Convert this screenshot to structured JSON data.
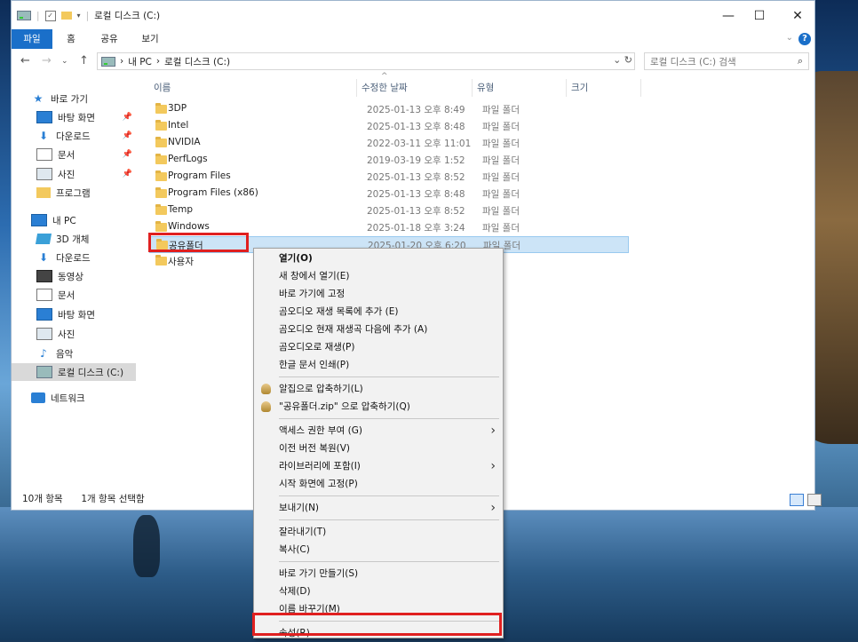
{
  "window": {
    "title": "로컬 디스크 (C:)",
    "controls": {
      "minimize": "—",
      "maximize": "☐",
      "close": "✕"
    }
  },
  "ribbon": {
    "tabs": [
      "파일",
      "홈",
      "공유",
      "보기"
    ]
  },
  "nav": {
    "back": "←",
    "forward": "→",
    "recent": "⌄",
    "up": "↑",
    "breadcrumb": [
      "내 PC",
      "로컬 디스크 (C:)"
    ],
    "breadcrumb_sep": "›",
    "refresh": "⌄ ↻",
    "search_placeholder": "로컬 디스크 (C:) 검색"
  },
  "sidebar": {
    "items": [
      {
        "label": "바로 가기",
        "icon": "star-icon"
      },
      {
        "label": "바탕 화면",
        "icon": "desktop-icon",
        "pinned": true
      },
      {
        "label": "다운로드",
        "icon": "download-icon",
        "pinned": true
      },
      {
        "label": "문서",
        "icon": "document-icon",
        "pinned": true
      },
      {
        "label": "사진",
        "icon": "pictures-icon",
        "pinned": true
      },
      {
        "label": "프로그램",
        "icon": "folder-icon"
      },
      {
        "label": "내 PC",
        "icon": "pc-icon"
      },
      {
        "label": "3D 개체",
        "icon": "3d-objects-icon"
      },
      {
        "label": "다운로드",
        "icon": "download-icon"
      },
      {
        "label": "동영상",
        "icon": "video-icon"
      },
      {
        "label": "문서",
        "icon": "document-icon"
      },
      {
        "label": "바탕 화면",
        "icon": "desktop-icon"
      },
      {
        "label": "사진",
        "icon": "pictures-icon"
      },
      {
        "label": "음악",
        "icon": "music-icon"
      },
      {
        "label": "로컬 디스크 (C:)",
        "icon": "drive-icon",
        "selected": true
      },
      {
        "label": "네트워크",
        "icon": "network-icon"
      }
    ],
    "pin_glyph": "📌"
  },
  "columns": [
    "이름",
    "수정한 날짜",
    "유형",
    "크기"
  ],
  "sort_glyph": "^",
  "files": [
    {
      "name": "3DP",
      "date": "2025-01-13 오후 8:49",
      "type": "파일 폴더"
    },
    {
      "name": "Intel",
      "date": "2025-01-13 오후 8:48",
      "type": "파일 폴더"
    },
    {
      "name": "NVIDIA",
      "date": "2022-03-11 오후 11:01",
      "type": "파일 폴더"
    },
    {
      "name": "PerfLogs",
      "date": "2019-03-19 오후 1:52",
      "type": "파일 폴더"
    },
    {
      "name": "Program Files",
      "date": "2025-01-13 오후 8:52",
      "type": "파일 폴더"
    },
    {
      "name": "Program Files (x86)",
      "date": "2025-01-13 오후 8:48",
      "type": "파일 폴더"
    },
    {
      "name": "Temp",
      "date": "2025-01-13 오후 8:52",
      "type": "파일 폴더"
    },
    {
      "name": "Windows",
      "date": "2025-01-18 오후 3:24",
      "type": "파일 폴더"
    },
    {
      "name": "공유폴더",
      "date": "2025-01-20 오후 6:20",
      "type": "파일 폴더",
      "selected": true
    },
    {
      "name": "사용자",
      "date": "",
      "type": "더"
    }
  ],
  "status": {
    "count": "10개 항목",
    "selection": "1개 항목 선택함"
  },
  "context_menu": {
    "groups": [
      [
        {
          "label": "열기(O)",
          "bold": true
        },
        {
          "label": "새 창에서 열기(E)"
        },
        {
          "label": "바로 가기에 고정"
        },
        {
          "label": "곰오디오 재생 목록에 추가 (E)"
        },
        {
          "label": "곰오디오 현재 재생곡 다음에 추가 (A)"
        },
        {
          "label": "곰오디오로 재생(P)"
        },
        {
          "label": "한글 문서 인쇄(P)"
        }
      ],
      [
        {
          "label": "알집으로 압축하기(L)",
          "icon": "alzip-icon"
        },
        {
          "label": "\"공유폴더.zip\" 으로 압축하기(Q)",
          "icon": "alzip-icon"
        }
      ],
      [
        {
          "label": "액세스 권한 부여 (G)",
          "submenu": true
        },
        {
          "label": "이전 버전 복원(V)"
        },
        {
          "label": "라이브러리에 포함(I)",
          "submenu": true
        },
        {
          "label": "시작 화면에 고정(P)"
        }
      ],
      [
        {
          "label": "보내기(N)",
          "submenu": true
        }
      ],
      [
        {
          "label": "잘라내기(T)"
        },
        {
          "label": "복사(C)"
        }
      ],
      [
        {
          "label": "바로 가기 만들기(S)"
        },
        {
          "label": "삭제(D)"
        },
        {
          "label": "이름 바꾸기(M)"
        }
      ],
      [
        {
          "label": "속성(R)",
          "highlighted": true
        }
      ]
    ],
    "submenu_glyph": "›"
  },
  "colors": {
    "accent": "#1a6fc9",
    "selection": "#cce4f7",
    "highlight_box": "#e02020",
    "folder": "#f3c95d"
  }
}
